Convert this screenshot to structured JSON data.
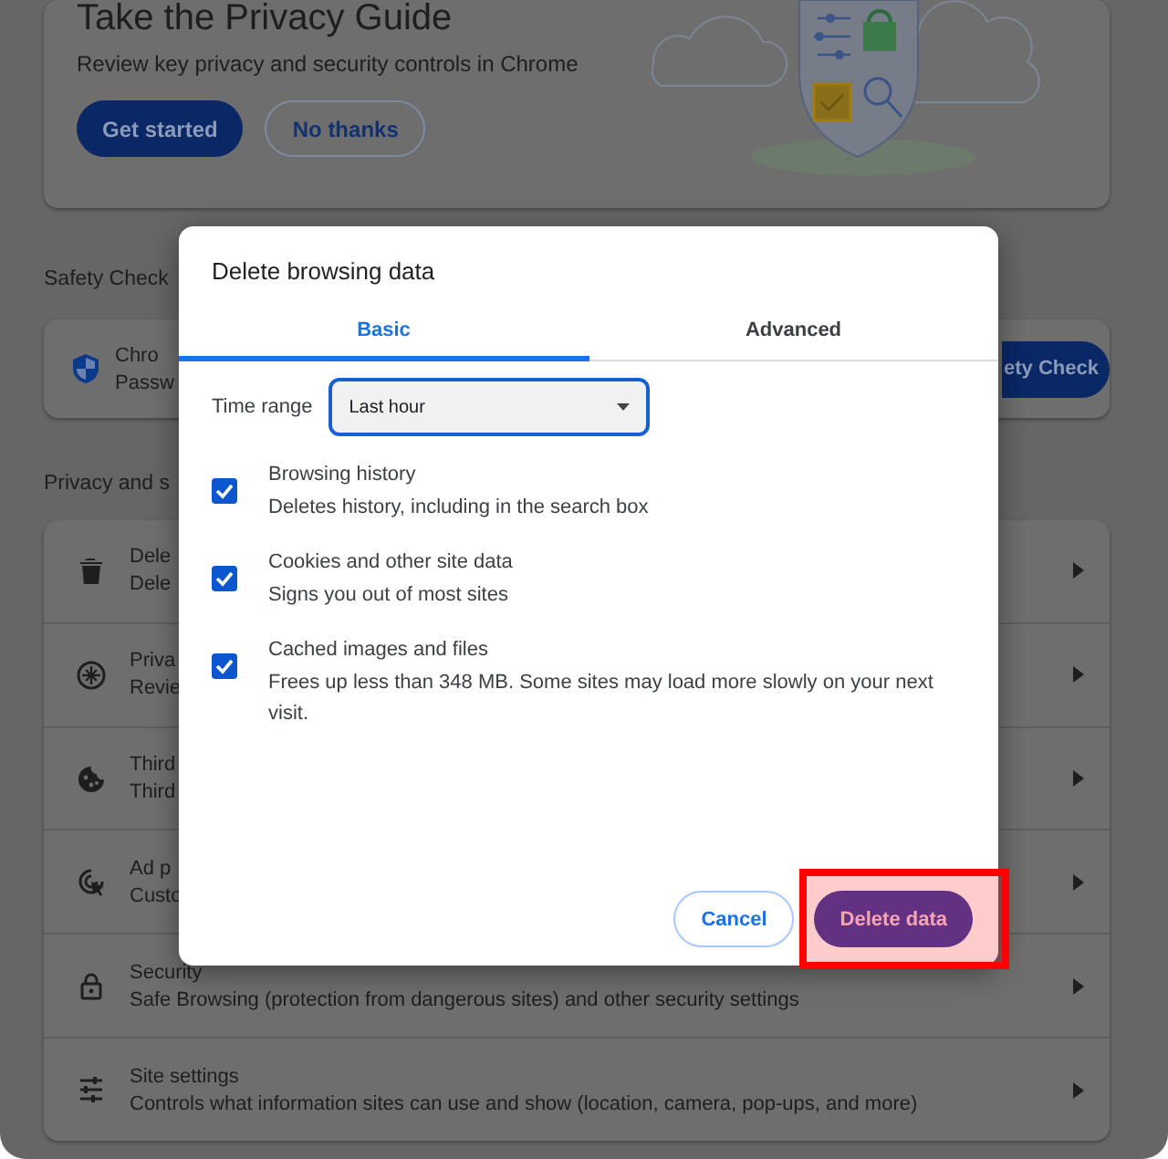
{
  "privacy_guide": {
    "title": "Take the Privacy Guide",
    "description": "Review key privacy and security controls in Chrome",
    "buttons": [
      {
        "label": "Get started",
        "kind": "primary"
      },
      {
        "label": "No thanks",
        "kind": "outlined"
      }
    ]
  },
  "safety_check": {
    "heading": "Safety Check",
    "item_title": "Chro",
    "item_subtitle": "Passw",
    "button": "ety Check"
  },
  "privacy_section": {
    "heading": "Privacy and s",
    "rows": [
      {
        "kind": "trash",
        "title": "Dele",
        "subtitle": "Dele"
      },
      {
        "kind": "compass",
        "title": "Priva",
        "subtitle": "Revie"
      },
      {
        "kind": "cookie",
        "title": "Third",
        "subtitle": "Third"
      },
      {
        "kind": "ad",
        "title": "Ad p",
        "subtitle": "Custo"
      },
      {
        "kind": "lock",
        "title": "Security",
        "subtitle": "Safe Browsing (protection from dangerous sites) and other security settings"
      },
      {
        "kind": "sliders",
        "title": "Site settings",
        "subtitle": "Controls what information sites can use and show (location, camera, pop-ups, and more)"
      }
    ]
  },
  "dialog": {
    "title": "Delete browsing data",
    "tabs": [
      {
        "label": "Basic",
        "selected": true
      },
      {
        "label": "Advanced",
        "selected": false
      }
    ],
    "time_range": {
      "label": "Time range",
      "value": "Last hour"
    },
    "options": [
      {
        "title": "Browsing history",
        "description": "Deletes history, including in the search box",
        "checked": true
      },
      {
        "title": "Cookies and other site data",
        "description": "Signs you out of most sites",
        "checked": true
      },
      {
        "title": "Cached images and files",
        "description": "Frees up less than 348 MB. Some sites may load more slowly on your next visit.",
        "checked": true
      }
    ],
    "buttons": [
      {
        "label": "Cancel",
        "kind": "secondary"
      },
      {
        "label": "Delete data",
        "kind": "primary",
        "highlighted": true
      }
    ]
  }
}
